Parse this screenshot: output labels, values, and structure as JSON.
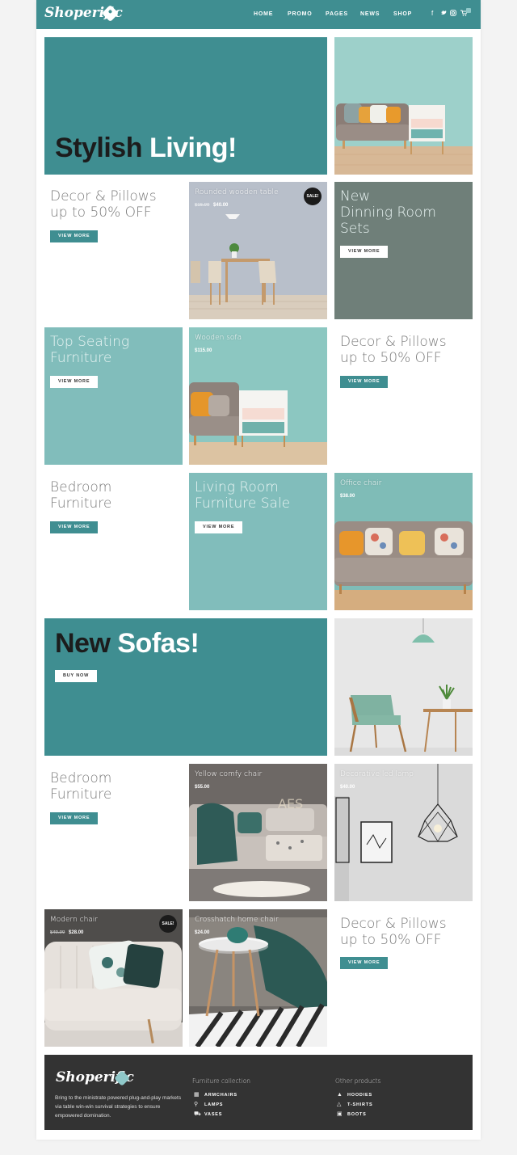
{
  "brand": {
    "name": "Shoperific"
  },
  "nav": {
    "items": [
      "HOME",
      "PROMO",
      "PAGES",
      "NEWS",
      "SHOP"
    ],
    "social_icons": [
      "facebook-icon",
      "twitter-icon",
      "instagram-icon",
      "cart-icon"
    ]
  },
  "hero": {
    "title_dark": "Stylish",
    "title_light": "Living!"
  },
  "promos": {
    "decor1": {
      "line1": "Decor & Pillows",
      "line2": "up to 50% OFF",
      "button": "VIEW MORE"
    },
    "dinning": {
      "line1": "New",
      "line2": "Dinning Room",
      "line3": "Sets",
      "button": "VIEW MORE"
    },
    "seating": {
      "line1": "Top Seating",
      "line2": "Furniture",
      "button": "VIEW MORE"
    },
    "decor2": {
      "line1": "Decor & Pillows",
      "line2": "up to 50% OFF",
      "button": "VIEW MORE"
    },
    "bedroom1": {
      "line1": "Bedroom",
      "line2": "Furniture",
      "button": "VIEW MORE"
    },
    "livingroom": {
      "line1": "Living Room",
      "line2": "Furniture Sale",
      "button": "VIEW MORE"
    },
    "bedroom2": {
      "line1": "Bedroom",
      "line2": "Furniture",
      "button": "VIEW MORE"
    },
    "decor3": {
      "line1": "Decor & Pillows",
      "line2": "up to 50% OFF",
      "button": "VIEW MORE"
    }
  },
  "sofas_banner": {
    "title_dark": "New",
    "title_light": "Sofas!",
    "button": "BUY NOW"
  },
  "products": {
    "wooden_table": {
      "name": "Rounded wooden table",
      "old_price": "$16.00",
      "price": "$40.00",
      "badge": "SALE!"
    },
    "wooden_sofa": {
      "name": "Wooden sofa",
      "price": "$115.00"
    },
    "office_chair": {
      "name": "Office chair",
      "price": "$38.00"
    },
    "yellow_chair": {
      "name": "Yellow comfy chair",
      "price": "$55.00"
    },
    "led_lamp": {
      "name": "Decorative led lamp",
      "price": "$40.00"
    },
    "modern_chair": {
      "name": "Modern chair",
      "old_price": "$40.00",
      "price": "$28.00",
      "badge": "SALE!"
    },
    "crosshatch_chair": {
      "name": "Crosshatch home chair",
      "price": "$24.00"
    }
  },
  "footer": {
    "description": "Bring to the ministrate powered plug-and-play markets via table win-win survival strategies to ensure empowered domination.",
    "col1": {
      "title": "Furniture collection",
      "links": [
        "ARMCHAIRS",
        "LAMPS",
        "VASES"
      ]
    },
    "col2": {
      "title": "Other products",
      "links": [
        "HOODIES",
        "T-SHIRTS",
        "BOOTS"
      ]
    }
  },
  "colors": {
    "accent": "#3f8e91",
    "light_accent": "#81bdbb",
    "slate": "#6f7f79",
    "footer_bg": "#333333"
  }
}
